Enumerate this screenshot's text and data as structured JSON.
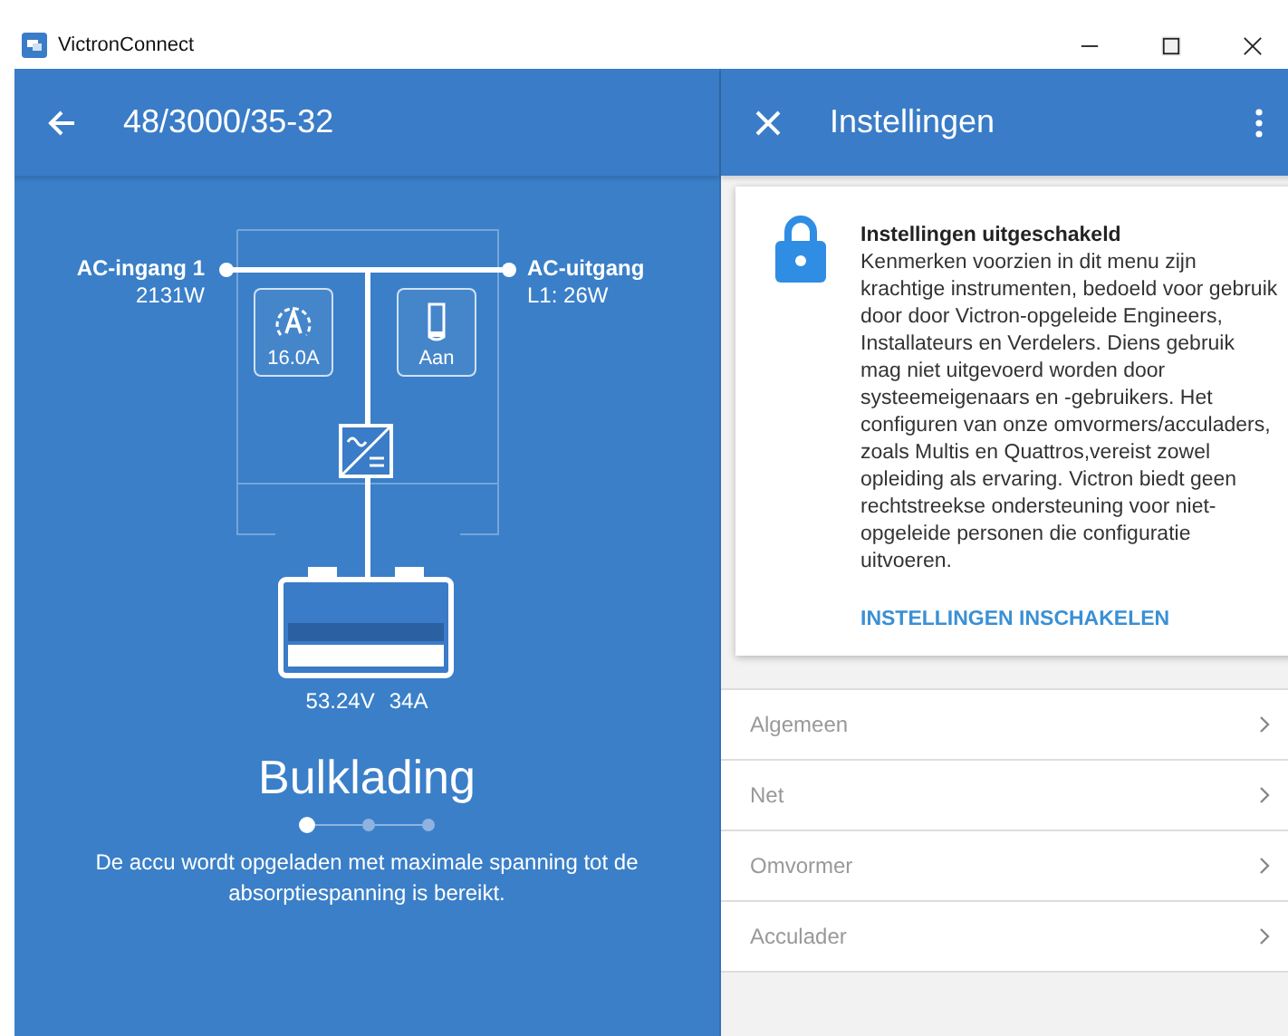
{
  "window": {
    "title": "VictronConnect"
  },
  "device": {
    "title": "48/3000/35-32",
    "ac_input": {
      "label": "AC-ingang 1",
      "value": "2131W"
    },
    "ac_output": {
      "label": "AC-uitgang",
      "value": "L1: 26W"
    },
    "current_limit": "16.0A",
    "switch_state": "Aan",
    "battery": {
      "voltage": "53.24V",
      "current": "34A"
    },
    "state": "Bulklading",
    "steps": [
      {
        "selected": true
      },
      {
        "selected": false
      },
      {
        "selected": false
      }
    ],
    "description": "De accu wordt opgeladen met maximale spanning tot de absorptiespanning is bereikt."
  },
  "settings": {
    "title": "Instellingen",
    "notice": {
      "title": "Instellingen uitgeschakeld",
      "text": "Kenmerken voorzien in dit menu zijn krachtige instrumenten, bedoeld voor gebruik door door Victron-opgeleide Engineers, Installateurs en Verdelers. Diens gebruik mag niet uitgevoerd worden door systeemeigenaars en -gebruikers. Het configuren van onze omvormers/acculaders, zoals Multis en Quattros,vereist zowel opleiding als ervaring. Victron biedt geen rechtstreekse ondersteuning voor niet-opgeleide personen die configuratie uitvoeren.",
      "action": "INSTELLINGEN INSCHAKELEN"
    },
    "items": [
      {
        "label": "Algemeen"
      },
      {
        "label": "Net"
      },
      {
        "label": "Omvormer"
      },
      {
        "label": "Acculader"
      }
    ]
  }
}
